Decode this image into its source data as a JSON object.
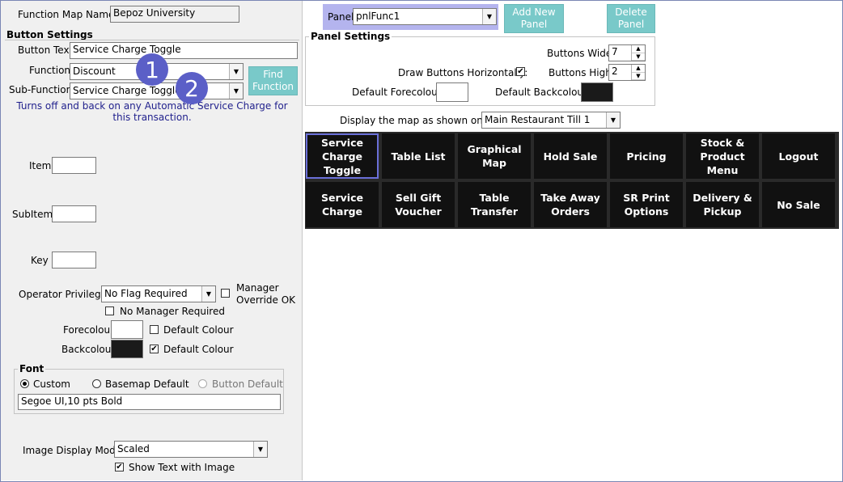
{
  "header": {
    "function_map_label": "Function Map Name:",
    "function_map_value": "Bepoz University",
    "panel_label": "Panel",
    "panel_value": "pnlFunc1",
    "add_panel": "Add New\nPanel",
    "delete_panel": "Delete\nPanel"
  },
  "button_settings": {
    "title": "Button Settings",
    "button_text_label": "Button Text",
    "button_text_value": "Service Charge Toggle",
    "function_label": "Function",
    "function_value": "Discount",
    "sub_function_label": "Sub-Function",
    "sub_function_value": "Service Charge Toggle",
    "find_function": "Find\nFunction",
    "description": "Turns off and back on any Automatic Service Charge for this transaction.",
    "item_label": "Item",
    "subitem_label": "SubItem",
    "key_label": "Key",
    "operator_privilege_label": "Operator Privilege:",
    "operator_privilege_value": "No Flag Required",
    "manager_override_label": "Manager\nOverride OK",
    "no_manager_label": "No Manager Required",
    "forecolour_label": "Forecolour",
    "backcolour_label": "Backcolour",
    "default_colour_label": "Default Colour",
    "default_colour_label2": "Default Colour"
  },
  "font": {
    "title": "Font",
    "custom": "Custom",
    "basemap_default": "Basemap Default",
    "button_default": "Button Default",
    "font_value": "Segoe UI,10 pts Bold"
  },
  "image": {
    "mode_label": "Image Display Mode:",
    "mode_value": "Scaled",
    "show_text_label": "Show Text with Image"
  },
  "panel_settings": {
    "title": "Panel Settings",
    "buttons_wide_label": "Buttons Wide:",
    "buttons_wide_value": "7",
    "draw_horiz_label": "Draw Buttons Horizontally:",
    "buttons_high_label": "Buttons High:",
    "buttons_high_value": "2",
    "default_forecolour_label": "Default Forecolour",
    "default_backcolour_label": "Default Backcolour"
  },
  "display": {
    "label": "Display the map as shown on till:",
    "value": "Main Restaurant Till 1"
  },
  "badges": [
    "1",
    "2"
  ],
  "tiles": [
    [
      "Service\nCharge\nToggle",
      "Table List",
      "Graphical\nMap",
      "Hold Sale",
      "Pricing",
      "Stock &\nProduct\nMenu",
      "Logout"
    ],
    [
      "Service\nCharge",
      "Sell Gift\nVoucher",
      "Table\nTransfer",
      "Take Away\nOrders",
      "SR Print\nOptions",
      "Delivery &\nPickup",
      "No Sale"
    ]
  ],
  "colors": {
    "teal": "#79c9c9",
    "panel_highlight": "#b4b4ee",
    "badge": "#5b5fc7",
    "tile_bg": "#111111",
    "description": "#1f1f8c"
  },
  "icons": {
    "dropdown": "chevron-down-icon",
    "check": "checkmark-icon"
  }
}
